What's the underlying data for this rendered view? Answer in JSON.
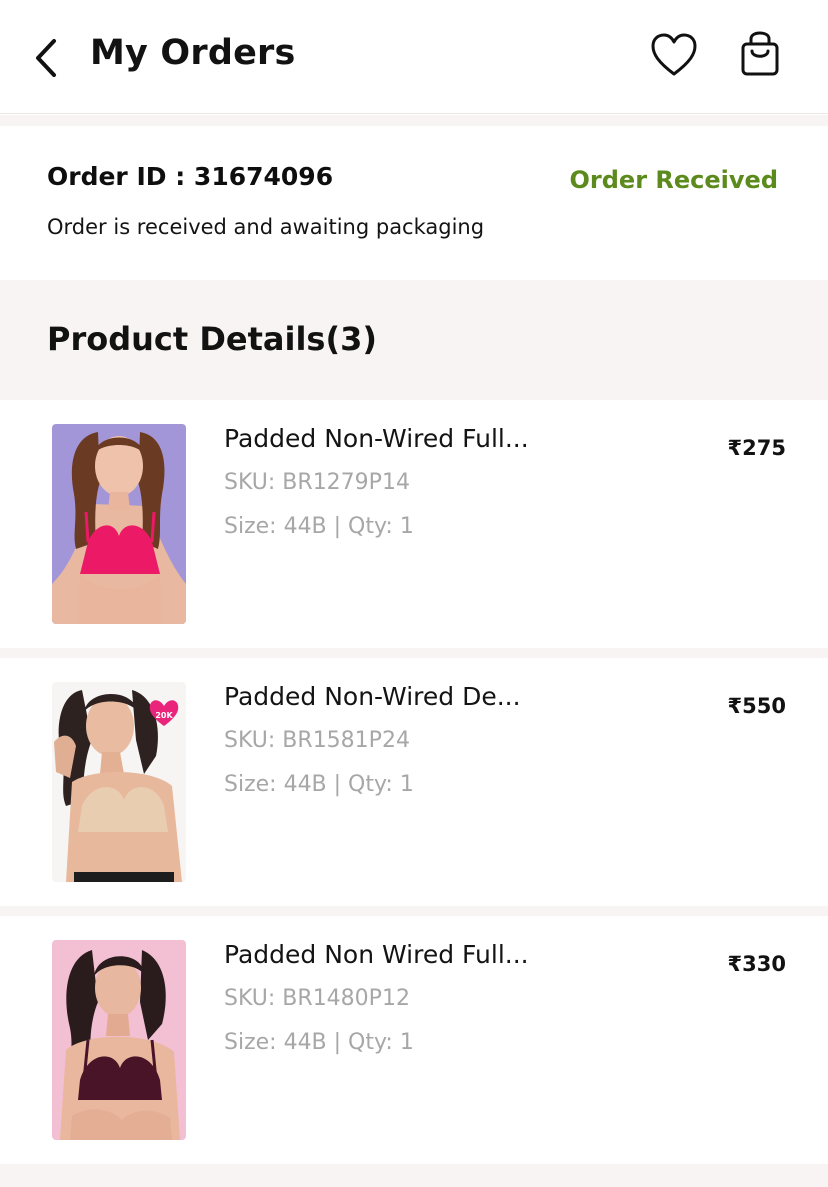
{
  "header": {
    "title": "My Orders",
    "back_icon": "chevron-left-icon",
    "wishlist_icon": "heart-icon",
    "bag_icon": "shopping-bag-icon"
  },
  "order": {
    "id_label": "Order ID : 31674096",
    "status": "Order Received",
    "status_color": "#5c8a1c",
    "message": "Order is received and awaiting packaging"
  },
  "product_details": {
    "title": "Product Details(3)"
  },
  "items": [
    {
      "name": "Padded Non-Wired Full...",
      "sku": "SKU: BR1279P14",
      "size_qty": "Size: 44B | Qty:  1",
      "price": "₹275",
      "image_alt": "model in pink bra on lavender background"
    },
    {
      "name": "Padded Non-Wired De...",
      "sku": "SKU: BR1581P24",
      "size_qty": "Size: 44B | Qty:  1",
      "price": "₹550",
      "badge": "20K",
      "image_alt": "model in nude bra on white background"
    },
    {
      "name": "Padded Non Wired Full...",
      "sku": "SKU: BR1480P12",
      "size_qty": "Size: 44B | Qty:  1",
      "price": "₹330",
      "image_alt": "model in maroon bra on pink background"
    }
  ],
  "colors": {
    "band_background": "#f8f4f3",
    "secondary_text": "#a7a7a7"
  }
}
